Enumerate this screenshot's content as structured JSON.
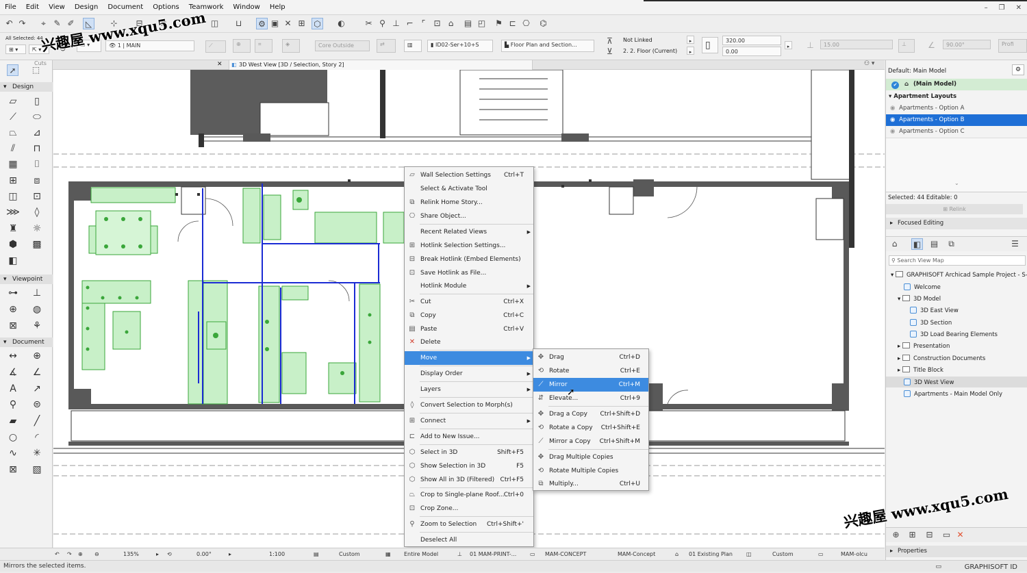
{
  "menubar": {
    "items": [
      "File",
      "Edit",
      "View",
      "Design",
      "Document",
      "Options",
      "Teamwork",
      "Window",
      "Help"
    ]
  },
  "infobox": {
    "all_selected": "All Selected: 44",
    "layer_short": "1 | MAIN",
    "core": "Core Outside",
    "composite": "ID02-Ser+10+S",
    "floor_plan": "Floor Plan and Section...",
    "not_linked": "Not Linked",
    "floor": "2. 2. Floor (Current)",
    "height": "320.00",
    "offset": "0.00",
    "thickness": "15.00",
    "angle": "90.00°",
    "profile": "Profi"
  },
  "tab": {
    "title": "3D West View [3D / Selection, Story 2]",
    "side_label": "Cuts"
  },
  "toolbox": {
    "sections": [
      "Design",
      "Viewpoint",
      "Document"
    ]
  },
  "navigator": {
    "default_label": "Default: Main Model",
    "main_model": "(Main Model)",
    "layouts_header": "Apartment Layouts",
    "options": [
      "Apartments - Option A",
      "Apartments - Option B",
      "Apartments - Option C"
    ],
    "selected_info": "Selected: 44 Editable: 0",
    "relink": "Relink",
    "focused": "Focused Editing",
    "search_placeholder": "Search View Map",
    "tree": {
      "root": "GRAPHISOFT Archicad Sample Project - S-Li",
      "welcome": "Welcome",
      "model3d": "3D Model",
      "east": "3D East View",
      "section": "3D Section",
      "load": "3D Load Bearing Elements",
      "presentation": "Presentation",
      "construction": "Construction Documents",
      "title_block": "Title Block",
      "west": "3D West View",
      "apartments_main": "Apartments - Main Model Only"
    },
    "properties": "Properties"
  },
  "context_menu": {
    "items": [
      {
        "label": "Wall Selection Settings",
        "shortcut": "Ctrl+T"
      },
      {
        "label": "Select & Activate Tool",
        "shortcut": ""
      },
      {
        "label": "Relink Home Story...",
        "shortcut": ""
      },
      {
        "label": "Share Object...",
        "shortcut": ""
      },
      {
        "label": "Recent Related Views",
        "shortcut": ""
      },
      {
        "label": "Hotlink Selection Settings...",
        "shortcut": ""
      },
      {
        "label": "Break Hotlink (Embed Elements)",
        "shortcut": ""
      },
      {
        "label": "Save Hotlink as File...",
        "shortcut": ""
      },
      {
        "label": "Hotlink Module",
        "shortcut": ""
      },
      {
        "label": "Cut",
        "shortcut": "Ctrl+X"
      },
      {
        "label": "Copy",
        "shortcut": "Ctrl+C"
      },
      {
        "label": "Paste",
        "shortcut": "Ctrl+V"
      },
      {
        "label": "Delete",
        "shortcut": ""
      },
      {
        "label": "Move",
        "shortcut": ""
      },
      {
        "label": "Display Order",
        "shortcut": ""
      },
      {
        "label": "Layers",
        "shortcut": ""
      },
      {
        "label": "Convert Selection to Morph(s)",
        "shortcut": ""
      },
      {
        "label": "Connect",
        "shortcut": ""
      },
      {
        "label": "Add to New Issue...",
        "shortcut": ""
      },
      {
        "label": "Select in 3D",
        "shortcut": "Shift+F5"
      },
      {
        "label": "Show Selection in 3D",
        "shortcut": "F5"
      },
      {
        "label": "Show All in 3D (Filtered)",
        "shortcut": "Ctrl+F5"
      },
      {
        "label": "Crop to Single-plane Roof...",
        "shortcut": "Ctrl+0"
      },
      {
        "label": "Crop Zone...",
        "shortcut": ""
      },
      {
        "label": "Zoom to Selection",
        "shortcut": "Ctrl+Shift+'"
      },
      {
        "label": "Deselect All",
        "shortcut": ""
      }
    ]
  },
  "submenu": {
    "items": [
      {
        "label": "Drag",
        "shortcut": "Ctrl+D"
      },
      {
        "label": "Rotate",
        "shortcut": "Ctrl+E"
      },
      {
        "label": "Mirror",
        "shortcut": "Ctrl+M"
      },
      {
        "label": "Elevate...",
        "shortcut": "Ctrl+9"
      },
      {
        "label": "Drag a Copy",
        "shortcut": "Ctrl+Shift+D"
      },
      {
        "label": "Rotate a Copy",
        "shortcut": "Ctrl+Shift+E"
      },
      {
        "label": "Mirror a Copy",
        "shortcut": "Ctrl+Shift+M"
      },
      {
        "label": "Drag Multiple Copies",
        "shortcut": ""
      },
      {
        "label": "Rotate Multiple Copies",
        "shortcut": ""
      },
      {
        "label": "Multiply...",
        "shortcut": "Ctrl+U"
      }
    ]
  },
  "statusbar": {
    "zoom": "135%",
    "angle": "0.00°",
    "scale": "1:100",
    "custom1": "Custom",
    "entire": "Entire Model",
    "print": "01 MAM-PRINT-...",
    "concept": "MAM-CONCEPT",
    "mam_concept": "MAM-Concept",
    "existing": "01 Existing Plan",
    "custom2": "Custom",
    "mam_olcu": "MAM-olcu"
  },
  "hint": "Mirrors the selected items.",
  "brand": "GRAPHISOFT ID",
  "watermark": {
    "top": "兴趣屋 www.xqu5.com",
    "bottom": "兴趣屋 www.xqu5.com"
  },
  "colors": {
    "highlight": "#3d8be0",
    "selection_fill": "#c8f0c8",
    "selection_stroke": "#3aa63a",
    "hotlink_blue": "#1a2bd4",
    "wall": "#5a5a5a"
  }
}
